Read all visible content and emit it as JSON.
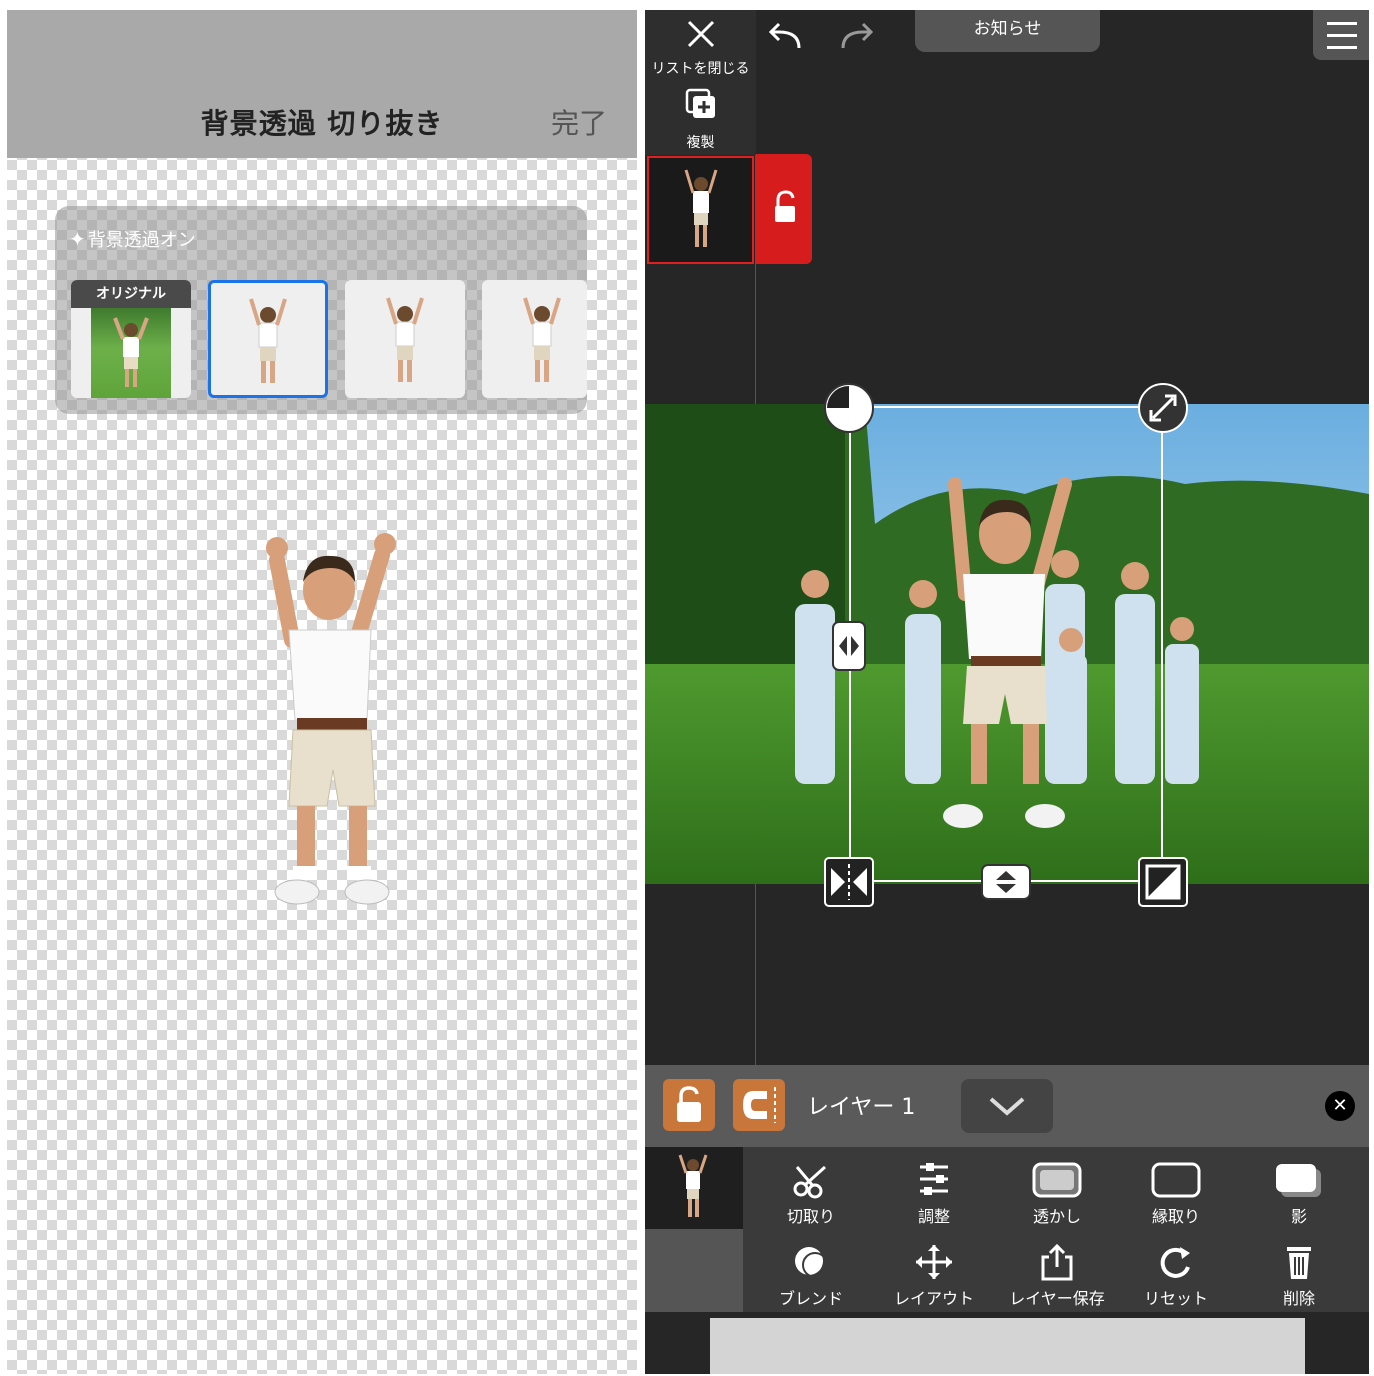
{
  "left": {
    "title": "背景透過 切り抜き",
    "done": "完了",
    "bg_toggle": "背景透過オン",
    "thumbs": [
      {
        "label": "オリジナル",
        "selected": false
      },
      {
        "label": "",
        "selected": true
      },
      {
        "label": "",
        "selected": false
      },
      {
        "label": "",
        "selected": false
      }
    ]
  },
  "right": {
    "close_label": "リストを閉じる",
    "notice": "お知らせ",
    "duplicate_label": "複製",
    "layer_name": "レイヤー 1",
    "tools_row1": [
      "切取り",
      "調整",
      "透かし",
      "縁取り",
      "影"
    ],
    "tools_row2": [
      "ブレンド",
      "レイアウト",
      "レイヤー保存",
      "リセット",
      "削除"
    ]
  },
  "colors": {
    "accent_blue": "#1a73e8",
    "lock_red": "#d61c1c",
    "layer_orange": "#c8763a"
  }
}
